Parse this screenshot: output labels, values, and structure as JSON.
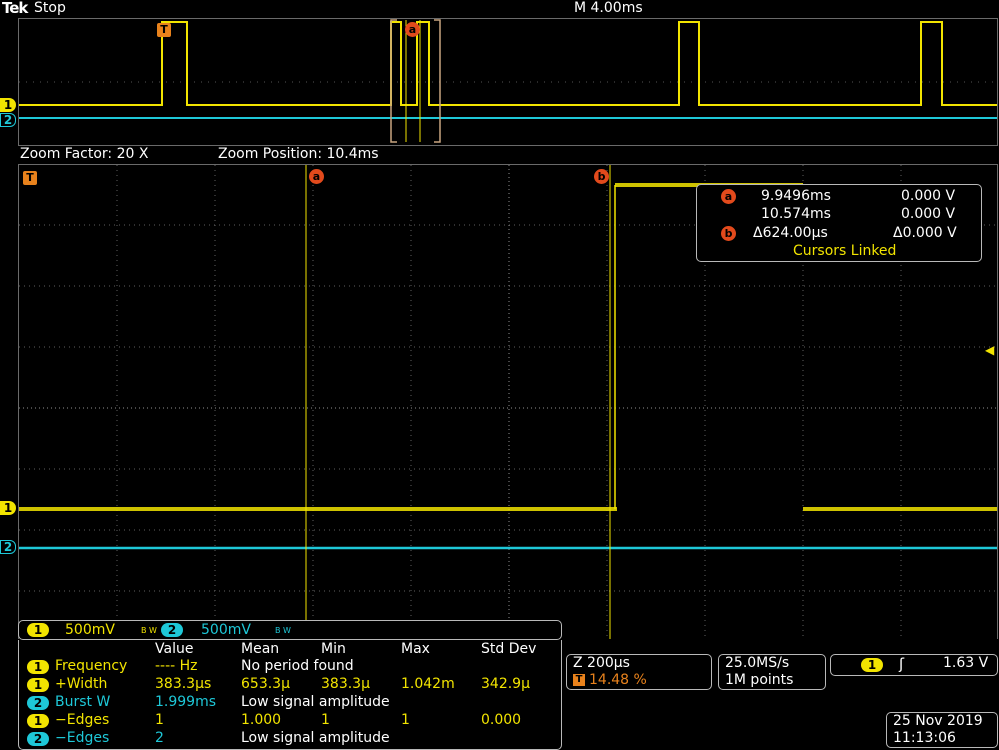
{
  "header": {
    "brand": "Tek",
    "run_state": "Stop",
    "timebase": "M 4.00ms"
  },
  "zoom": {
    "factor_label": "Zoom Factor: 20 X",
    "position_label": "Zoom Position: 10.4ms"
  },
  "markers": {
    "trigger": "T",
    "cursor_a": "a",
    "cursor_b": "b",
    "ch1": "1",
    "ch2": "2"
  },
  "cursor_readout": {
    "a_time": "9.9496ms",
    "a_volt": "0.000 V",
    "b_time": "10.574ms",
    "b_volt": "0.000 V",
    "delta_time": "Δ624.00µs",
    "delta_volt": "Δ0.000 V",
    "linked": "Cursors Linked"
  },
  "channels": [
    {
      "num": "1",
      "scale": "500mV",
      "bw": "B W",
      "color": "#f2e400"
    },
    {
      "num": "2",
      "scale": "500mV",
      "bw": "B W",
      "color": "#1ec8d8"
    }
  ],
  "measurements": {
    "headers": [
      "Value",
      "Mean",
      "Min",
      "Max",
      "Std Dev"
    ],
    "rows": [
      {
        "ch": "1",
        "name": "Frequency",
        "value": "---- Hz",
        "mean": "No period found",
        "min": "",
        "max": "",
        "std": ""
      },
      {
        "ch": "1",
        "name": "+Width",
        "value": "383.3µs",
        "mean": "653.3µ",
        "min": "383.3µ",
        "max": "1.042m",
        "std": "342.9µ"
      },
      {
        "ch": "2",
        "name": "Burst W",
        "value": "1.999ms",
        "mean": "Low signal amplitude",
        "min": "",
        "max": "",
        "std": ""
      },
      {
        "ch": "1",
        "name": "−Edges",
        "value": "1",
        "mean": "1.000",
        "min": "1",
        "max": "1",
        "std": "0.000"
      },
      {
        "ch": "2",
        "name": "−Edges",
        "value": "2",
        "mean": "Low signal amplitude",
        "min": "",
        "max": "",
        "std": ""
      }
    ]
  },
  "zoom_panel": {
    "scale": "Z 200µs",
    "trigger_pos": "14.48 %"
  },
  "acq_panel": {
    "rate": "25.0MS/s",
    "points": "1M points"
  },
  "trigger_panel": {
    "ch": "1",
    "slope": "ʃ",
    "level": "1.63 V"
  },
  "datetime": {
    "date": "25 Nov 2019",
    "time": "11:13:06"
  }
}
